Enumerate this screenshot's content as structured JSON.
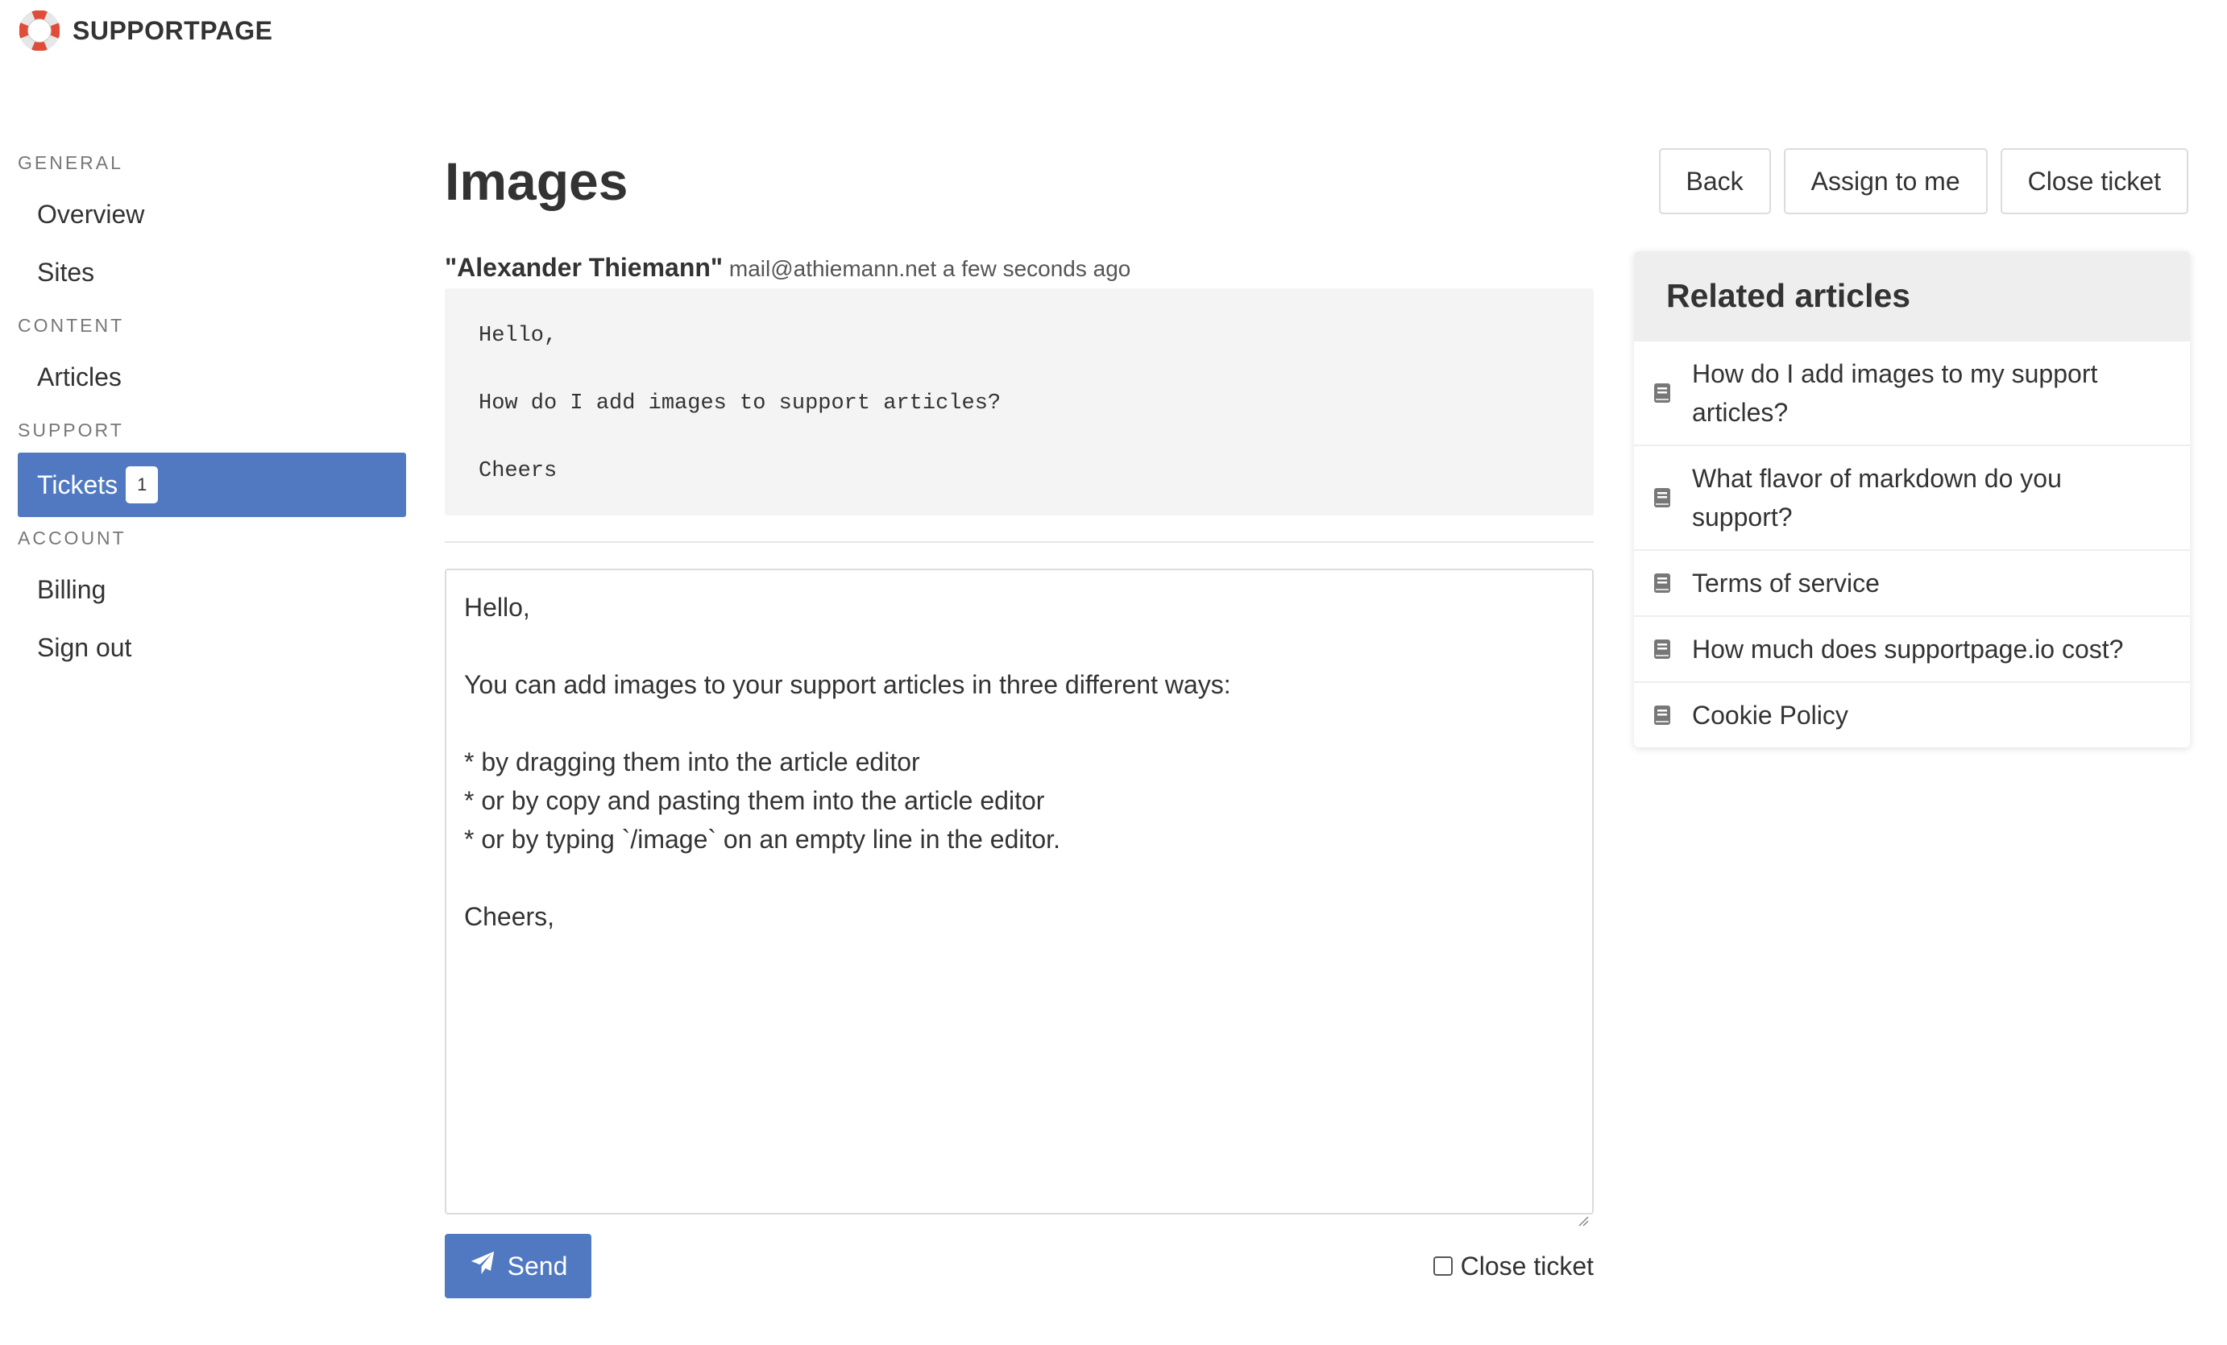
{
  "app": {
    "name": "SUPPORTPAGE"
  },
  "sidebar": {
    "sections": [
      {
        "heading": "GENERAL",
        "items": [
          {
            "label": "Overview"
          },
          {
            "label": "Sites"
          }
        ]
      },
      {
        "heading": "CONTENT",
        "items": [
          {
            "label": "Articles"
          }
        ]
      },
      {
        "heading": "SUPPORT",
        "items": [
          {
            "label": "Tickets",
            "badge": "1",
            "active": true
          }
        ]
      },
      {
        "heading": "ACCOUNT",
        "items": [
          {
            "label": "Billing"
          },
          {
            "label": "Sign out"
          }
        ]
      }
    ]
  },
  "header": {
    "title": "Images",
    "buttons": {
      "back": "Back",
      "assign": "Assign to me",
      "close": "Close ticket"
    }
  },
  "ticket": {
    "sender_name": "\"Alexander Thiemann\"",
    "sender_email": "mail@athiemann.net",
    "time": "a few seconds ago",
    "message_lines": [
      "Hello,",
      "",
      "How do I add images to support articles?",
      "",
      "Cheers"
    ]
  },
  "reply": {
    "lines": [
      "Hello,",
      "",
      "You can add images to your support articles in three different ways:",
      "",
      "* by dragging them into the article editor",
      "* or by copy and pasting them into the article editor",
      "* or by typing `/image` on an empty line in the editor.",
      "",
      "Cheers,"
    ],
    "send_label": "Send",
    "close_ticket_label": "Close ticket",
    "close_ticket_checked": false
  },
  "related": {
    "title": "Related articles",
    "items": [
      {
        "title_line1": "How do I add images to my support",
        "title_line2": "articles?"
      },
      {
        "title_line1": "What flavor of markdown do you",
        "title_line2": "support?"
      },
      {
        "title": "Terms of service"
      },
      {
        "title": "How much does supportpage.io cost?"
      },
      {
        "title": "Cookie Policy"
      }
    ]
  },
  "colors": {
    "accent": "#5079c2",
    "logo_red": "#e04b3a"
  },
  "icons": {
    "logo": "lifebuoy-icon",
    "send": "paper-plane-icon",
    "article": "book-icon"
  }
}
